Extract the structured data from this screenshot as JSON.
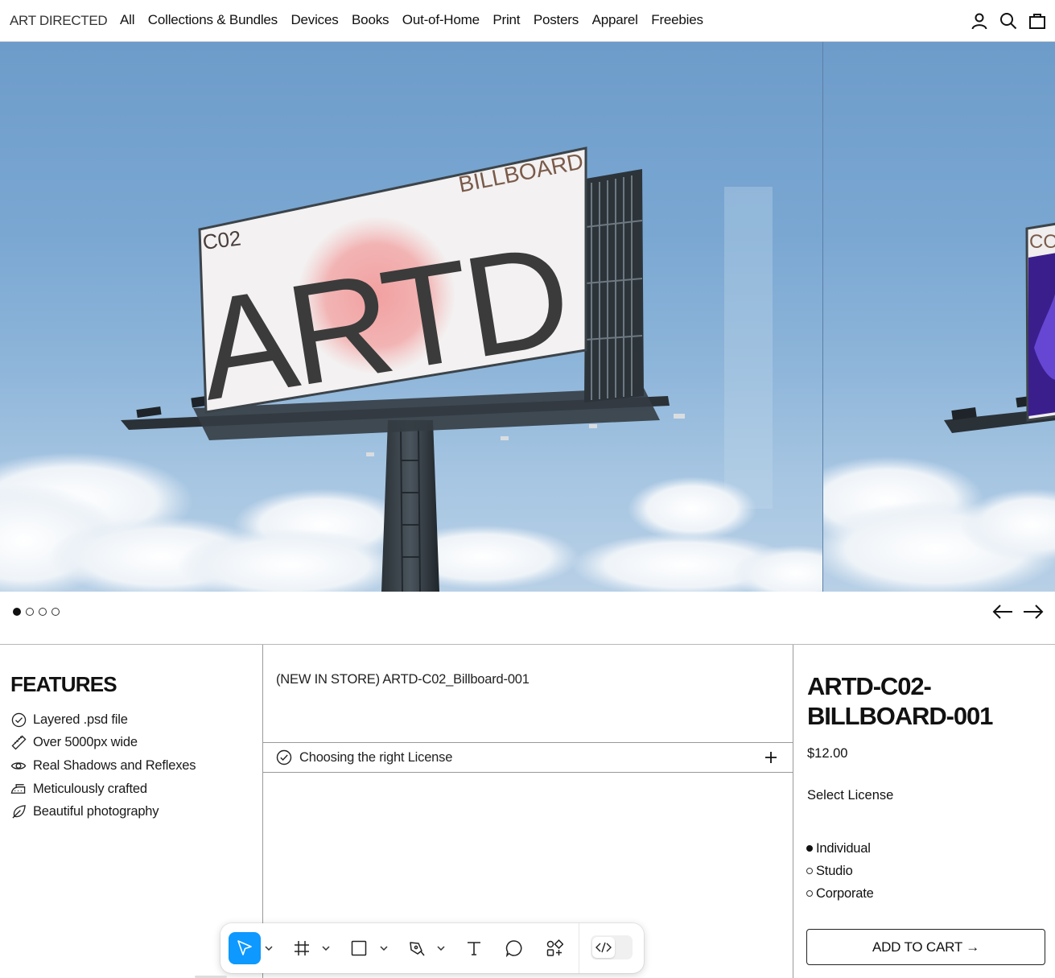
{
  "header": {
    "logo": "ART DIRECTED",
    "nav": [
      "All",
      "Collections & Bundles",
      "Devices",
      "Books",
      "Out-of-Home",
      "Print",
      "Posters",
      "Apparel",
      "Freebies"
    ],
    "icons": [
      "account-icon",
      "search-icon",
      "cart-icon"
    ]
  },
  "hero": {
    "billboard_text_top": "BILLBOARD",
    "billboard_text_left": "C02",
    "billboard_text_main": "ARTD",
    "next_slide_text": "CO",
    "colors": {
      "sky": "#7aa7d2",
      "accent_circle": "#f0a3a3",
      "billboard": "#f3f1f1"
    }
  },
  "pager": {
    "slide_count": 4,
    "active_index": 0
  },
  "features": {
    "title": "FEATURES",
    "items": [
      {
        "icon": "check-circle-icon",
        "label": "Layered .psd file"
      },
      {
        "icon": "ruler-icon",
        "label": "Over 5000px wide"
      },
      {
        "icon": "eye-icon",
        "label": "Real Shadows and Reflexes"
      },
      {
        "icon": "iron-icon",
        "label": "Meticulously crafted"
      },
      {
        "icon": "leaf-icon",
        "label": "Beautiful photography"
      }
    ]
  },
  "description": {
    "text": "(NEW IN STORE) ARTD-C02_Billboard-001",
    "accordion_label": "Choosing the right License"
  },
  "product": {
    "title": "ARTD-C02-BILLBOARD-001",
    "price": "$12.00",
    "license_label": "Select License",
    "licenses": [
      "Individual",
      "Studio",
      "Corporate"
    ],
    "selected_license": "Individual",
    "add_to_cart": "ADD TO CART →"
  },
  "toolbar": {
    "tools": [
      "move-tool-icon",
      "frame-tool-icon",
      "rectangle-tool-icon",
      "pen-tool-icon",
      "text-tool-icon",
      "comment-tool-icon",
      "actions-tool-icon",
      "dev-mode-icon"
    ],
    "active_tool": "move-tool-icon",
    "accent": "#0d99ff"
  }
}
